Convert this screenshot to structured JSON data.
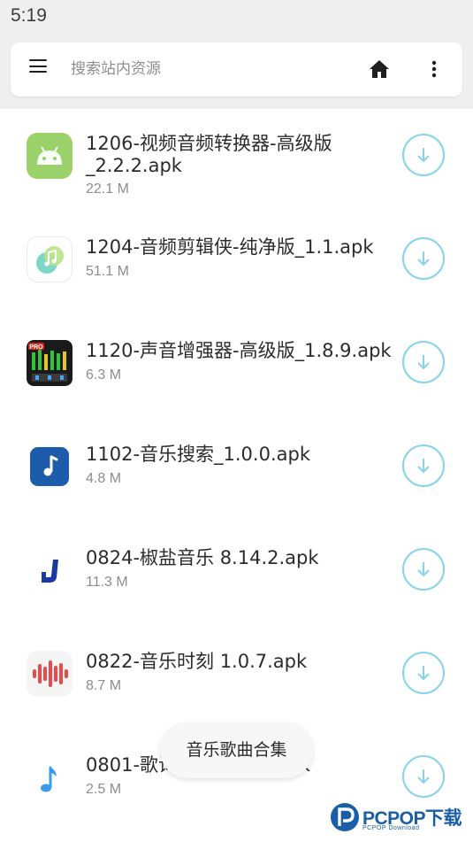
{
  "status_bar": {
    "time": "5:19"
  },
  "search_bar": {
    "placeholder": "搜索站内资源",
    "menu_icon": "menu-icon",
    "home_icon": "home-icon",
    "more_icon": "more-vertical-icon"
  },
  "files": [
    {
      "name": "1206-视频音频转换器-高级版_2.2.2.apk",
      "size": "22.1 M",
      "icon": "android-icon"
    },
    {
      "name": "1204-音频剪辑侠-纯净版_1.1.apk",
      "size": "51.1 M",
      "icon": "music-note-bubble-icon"
    },
    {
      "name": "1120-声音增强器-高级版_1.8.9.apk",
      "size": "6.3 M",
      "icon": "equalizer-pro-icon"
    },
    {
      "name": "1102-音乐搜索_1.0.0.apk",
      "size": "4.8 M",
      "icon": "music-note-square-icon"
    },
    {
      "name": "0824-椒盐音乐 8.14.2.apk",
      "size": "11.3 M",
      "icon": "j-logo-icon"
    },
    {
      "name": "0822-音乐时刻 1.0.7.apk",
      "size": "8.7 M",
      "icon": "sound-wave-icon"
    },
    {
      "name": "0801-歌词适配_4.1.0.apk",
      "size": "2.5 M",
      "icon": "music-note-icon"
    }
  ],
  "floating_chip": {
    "label": "音乐歌曲合集"
  },
  "watermark": {
    "brand": "PCPOP下载",
    "sub": "PCPOP Download"
  },
  "colors": {
    "accent": "#86d3ee",
    "status_bar_bg": "#efefef",
    "text_primary": "#2b2b2b",
    "text_secondary": "#8d8d8d"
  }
}
